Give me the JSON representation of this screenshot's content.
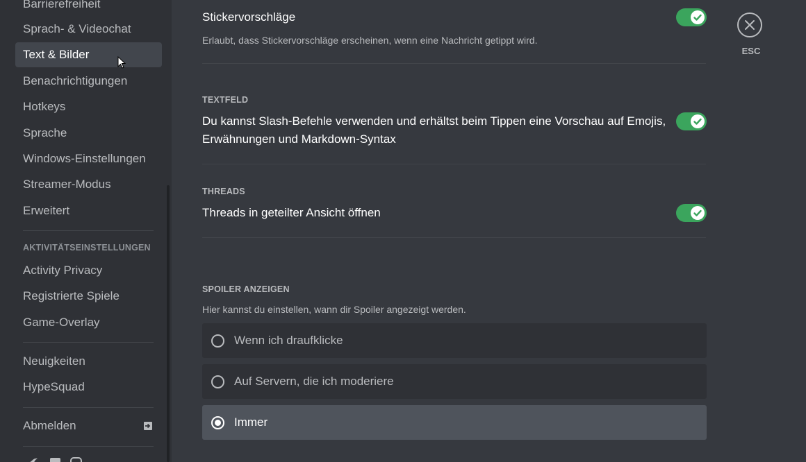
{
  "sidebar": {
    "items": [
      {
        "label": "Barrierefreiheit"
      },
      {
        "label": "Sprach- & Videochat"
      },
      {
        "label": "Text & Bilder"
      },
      {
        "label": "Benachrichtigungen"
      },
      {
        "label": "Hotkeys"
      },
      {
        "label": "Sprache"
      },
      {
        "label": "Windows-Einstellungen"
      },
      {
        "label": "Streamer-Modus"
      },
      {
        "label": "Erweitert"
      }
    ],
    "activity_header": "AKTIVITÄTSEINSTELLUNGEN",
    "activity_items": [
      {
        "label": "Activity Privacy"
      },
      {
        "label": "Registrierte Spiele"
      },
      {
        "label": "Game-Overlay"
      }
    ],
    "misc_items": [
      {
        "label": "Neuigkeiten"
      },
      {
        "label": "HypeSquad"
      }
    ],
    "logout_label": "Abmelden",
    "social_icons": [
      "twitter-icon",
      "facebook-icon",
      "instagram-icon"
    ]
  },
  "content": {
    "sticker": {
      "title": "Stickervorschläge",
      "description": "Erlaubt, dass Stickervorschläge erscheinen, wenn eine Nachricht getippt wird.",
      "enabled": true
    },
    "textfield": {
      "header": "TEXTFELD",
      "title_line1": "Du kannst Slash-Befehle verwenden und erhältst beim Tippen eine Vorschau auf Emojis,",
      "title_line2": "Erwähnungen und Markdown-Syntax",
      "enabled": true
    },
    "threads": {
      "header": "THREADS",
      "title": "Threads in geteilter Ansicht öffnen",
      "enabled": true
    },
    "spoiler": {
      "header": "SPOILER ANZEIGEN",
      "description": "Hier kannst du einstellen, wann dir Spoiler angezeigt werden.",
      "options": [
        {
          "label": "Wenn ich draufklicke",
          "selected": false
        },
        {
          "label": "Auf Servern, die ich moderiere",
          "selected": false
        },
        {
          "label": "Immer",
          "selected": true
        }
      ]
    }
  },
  "close": {
    "label": "ESC"
  },
  "colors": {
    "background": "#36393f",
    "sidebar": "#2f3136",
    "toggle_on": "#3ba55d",
    "selected_item": "#42464d"
  }
}
